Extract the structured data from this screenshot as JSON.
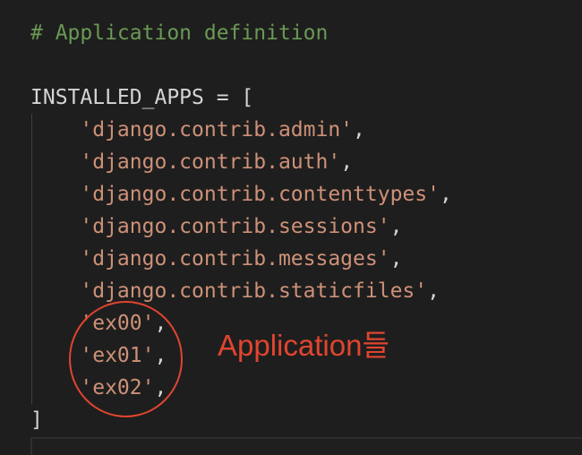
{
  "code": {
    "comment": "# Application definition",
    "declaration": "INSTALLED_APPS = [",
    "items": [
      {
        "value": "'django.contrib.admin'",
        "sep": ","
      },
      {
        "value": "'django.contrib.auth'",
        "sep": ","
      },
      {
        "value": "'django.contrib.contenttypes'",
        "sep": ","
      },
      {
        "value": "'django.contrib.sessions'",
        "sep": ","
      },
      {
        "value": "'django.contrib.messages'",
        "sep": ","
      },
      {
        "value": "'django.contrib.staticfiles'",
        "sep": ","
      },
      {
        "value": "'ex00'",
        "sep": ","
      },
      {
        "value": "'ex01'",
        "sep": ","
      },
      {
        "value": "'ex02'",
        "sep": ","
      }
    ],
    "closing": "]"
  },
  "annotation": {
    "text": "Application들",
    "color": "#e0452f"
  },
  "colors": {
    "background": "#1e1e1e",
    "comment": "#6a9955",
    "string": "#ce9178",
    "text": "#d4d4d4"
  }
}
